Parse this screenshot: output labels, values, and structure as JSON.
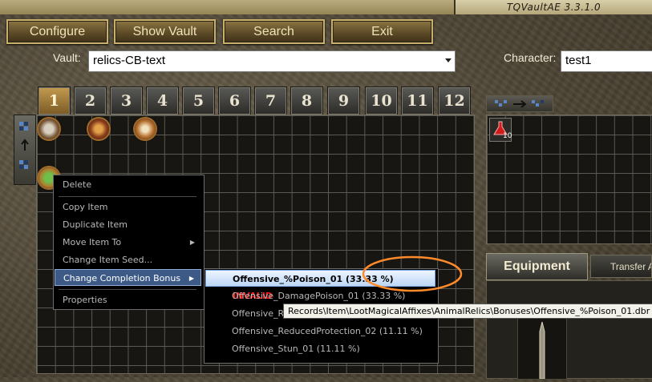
{
  "window": {
    "title": "TQVaultAE 3.3.1.0"
  },
  "toolbar": {
    "configure": "Configure",
    "show_vault": "Show Vault",
    "search": "Search",
    "exit": "Exit"
  },
  "vault": {
    "label": "Vault:",
    "value": "relics-CB-text"
  },
  "character": {
    "label": "Character:",
    "value": "test1"
  },
  "tabs": [
    "1",
    "2",
    "3",
    "4",
    "5",
    "6",
    "7",
    "8",
    "9",
    "10",
    "11",
    "12"
  ],
  "active_tab": "1",
  "stash": {
    "potion_count": "10"
  },
  "equipment": {
    "tab_label": "Equipment",
    "transfer_label": "Transfer A"
  },
  "context_menu": {
    "delete": "Delete",
    "copy": "Copy Item",
    "duplicate": "Duplicate Item",
    "move": "Move Item To",
    "seed": "Change Item Seed...",
    "completion": "Change Completion Bonus",
    "properties": "Properties"
  },
  "submenu": {
    "item1": "Offensive_%Poison_01 (33.33 %)",
    "item1_flag": "INVALID",
    "item2": "Offensive_DamagePoison_01 (33.33 %)",
    "item3": "Offensive_R",
    "item4": "Offensive_ReducedProtection_02 (11.11 %)",
    "item5": "Offensive_Stun_01 (11.11 %)"
  },
  "tooltip": "Records\\Item\\LootMagicalAffixes\\AnimalRelics\\Bonuses\\Offensive_%Poison_01.dbr",
  "colors": {
    "invalid": "#ff1a1a",
    "highlight_ring": "#ff8a2a",
    "menu_highlight": "#3d5a86"
  }
}
